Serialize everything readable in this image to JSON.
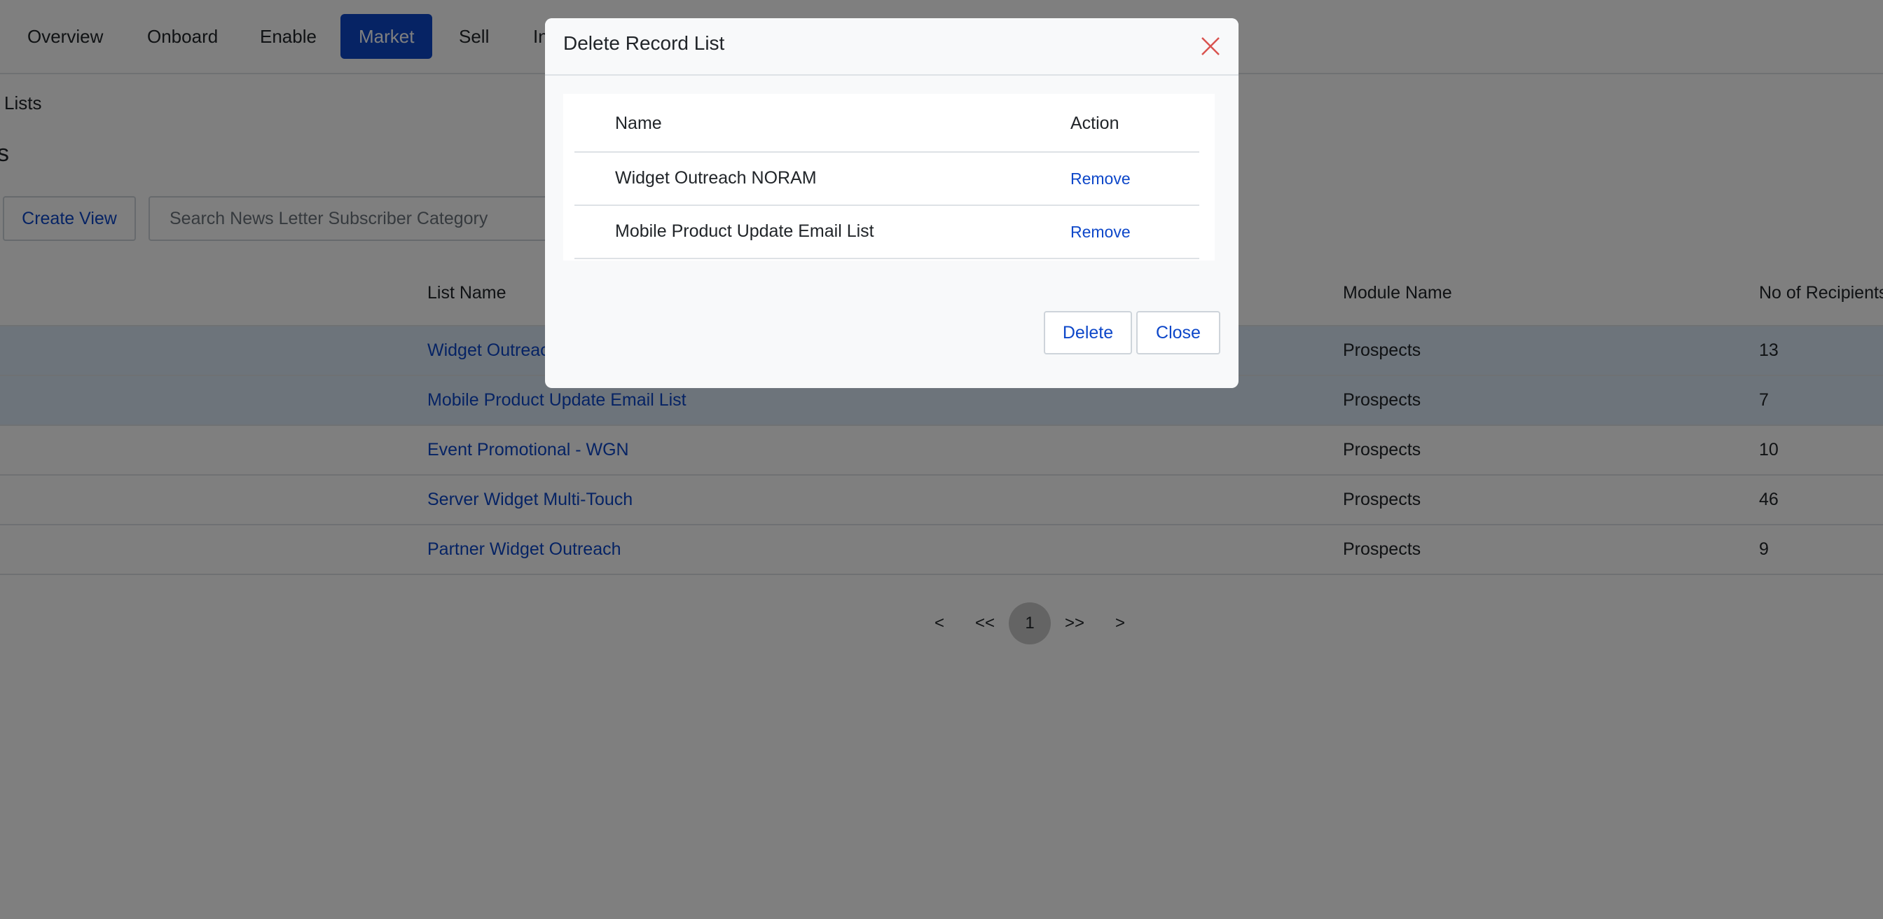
{
  "nav": {
    "items": [
      "Overview",
      "Onboard",
      "Enable",
      "Market",
      "Sell",
      "In"
    ],
    "active": "Market"
  },
  "breadcrumb": "Lists",
  "page_title": "s",
  "toolbar": {
    "create_view_label": "Create View",
    "search_placeholder": "Search News Letter Subscriber Category"
  },
  "table": {
    "headers": {
      "list_name": "List Name",
      "module_name": "Module Name",
      "recipients": "No of Recipients"
    },
    "rows": [
      {
        "list_name": "Widget Outreach NORAM",
        "module": "Prospects",
        "recipients": "13",
        "selected": true
      },
      {
        "list_name": "Mobile Product Update Email List",
        "module": "Prospects",
        "recipients": "7",
        "selected": true
      },
      {
        "list_name": "Event Promotional - WGN",
        "module": "Prospects",
        "recipients": "10",
        "selected": false
      },
      {
        "list_name": "Server Widget Multi-Touch",
        "module": "Prospects",
        "recipients": "46",
        "selected": false
      },
      {
        "list_name": "Partner Widget Outreach",
        "module": "Prospects",
        "recipients": "9",
        "selected": false
      }
    ]
  },
  "pagination": {
    "prev": "<",
    "first": "<<",
    "current": "1",
    "last": ">>",
    "next": ">"
  },
  "modal": {
    "title": "Delete Record List",
    "headers": {
      "name": "Name",
      "action": "Action"
    },
    "rows": [
      {
        "name": "Widget Outreach NORAM",
        "action": "Remove"
      },
      {
        "name": "Mobile Product Update Email List",
        "action": "Remove"
      }
    ],
    "delete_label": "Delete",
    "close_label": "Close"
  },
  "colors": {
    "accent": "#0d47c9",
    "close_icon": "#d9534f",
    "selected_row": "#dbe9f7"
  }
}
